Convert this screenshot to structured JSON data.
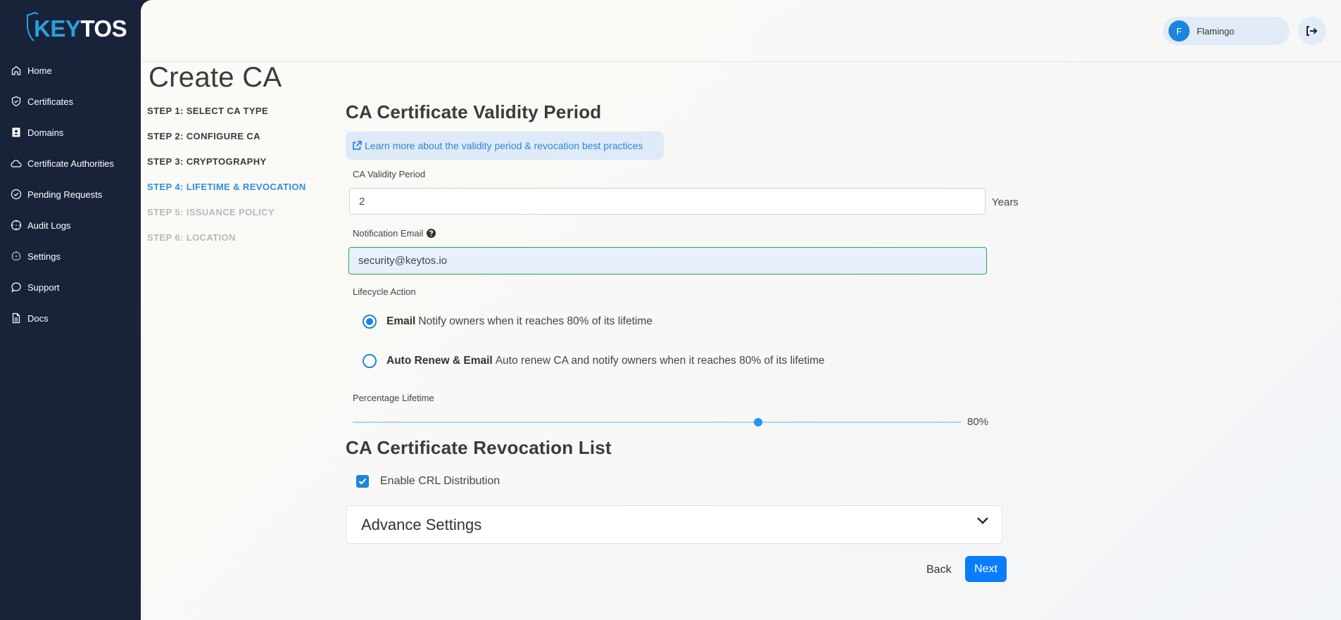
{
  "brand": {
    "logo_part1": "KEY",
    "logo_part2": "TOS",
    "accent_color": "#2a9fdc"
  },
  "sidebar": {
    "items": [
      {
        "label": "Home",
        "icon": "home-icon"
      },
      {
        "label": "Certificates",
        "icon": "shield-check-icon"
      },
      {
        "label": "Domains",
        "icon": "contact-book-icon"
      },
      {
        "label": "Certificate Authorities",
        "icon": "cloud-icon"
      },
      {
        "label": "Pending Requests",
        "icon": "check-circle-icon"
      },
      {
        "label": "Audit Logs",
        "icon": "crosshair-icon"
      },
      {
        "label": "Settings",
        "icon": "gear-icon"
      },
      {
        "label": "Support",
        "icon": "chat-bubble-icon"
      },
      {
        "label": "Docs",
        "icon": "document-icon"
      }
    ]
  },
  "header": {
    "user_initial": "F",
    "user_name": "Flamingo",
    "logout_icon": "logout-icon"
  },
  "page": {
    "title": "Create CA",
    "steps": [
      {
        "label": "STEP 1: SELECT CA TYPE",
        "state": "done"
      },
      {
        "label": "STEP 2: CONFIGURE CA",
        "state": "done"
      },
      {
        "label": "STEP 3: CRYPTOGRAPHY",
        "state": "done"
      },
      {
        "label": "STEP 4: LIFETIME & REVOCATION",
        "state": "active"
      },
      {
        "label": "STEP 5: ISSUANCE POLICY",
        "state": "disabled"
      },
      {
        "label": "STEP 6: LOCATION",
        "state": "disabled"
      }
    ]
  },
  "validity": {
    "section_title": "CA Certificate Validity Period",
    "learn_more": "Learn more about the validity period & revocation best practices",
    "period_label": "CA Validity Period",
    "period_value": "2",
    "period_unit": "Years",
    "email_label": "Notification Email",
    "email_value": "security@keytos.io",
    "lifecycle_label": "Lifecycle Action",
    "lifecycle_options": [
      {
        "title": "Email",
        "description": "Notify owners when it reaches 80% of its lifetime",
        "selected": true
      },
      {
        "title": "Auto Renew & Email",
        "description": "Auto renew CA and notify owners when it reaches 80% of its lifetime",
        "selected": false
      }
    ],
    "percentage_label": "Percentage Lifetime",
    "percentage_value": 80,
    "percentage_min": 0,
    "percentage_max": 120,
    "percentage_display": "80%"
  },
  "revocation": {
    "section_title": "CA Certificate Revocation List",
    "crl_label": "Enable CRL Distribution",
    "crl_checked": true
  },
  "advanced": {
    "title": "Advance Settings"
  },
  "actions": {
    "back": "Back",
    "next": "Next"
  }
}
